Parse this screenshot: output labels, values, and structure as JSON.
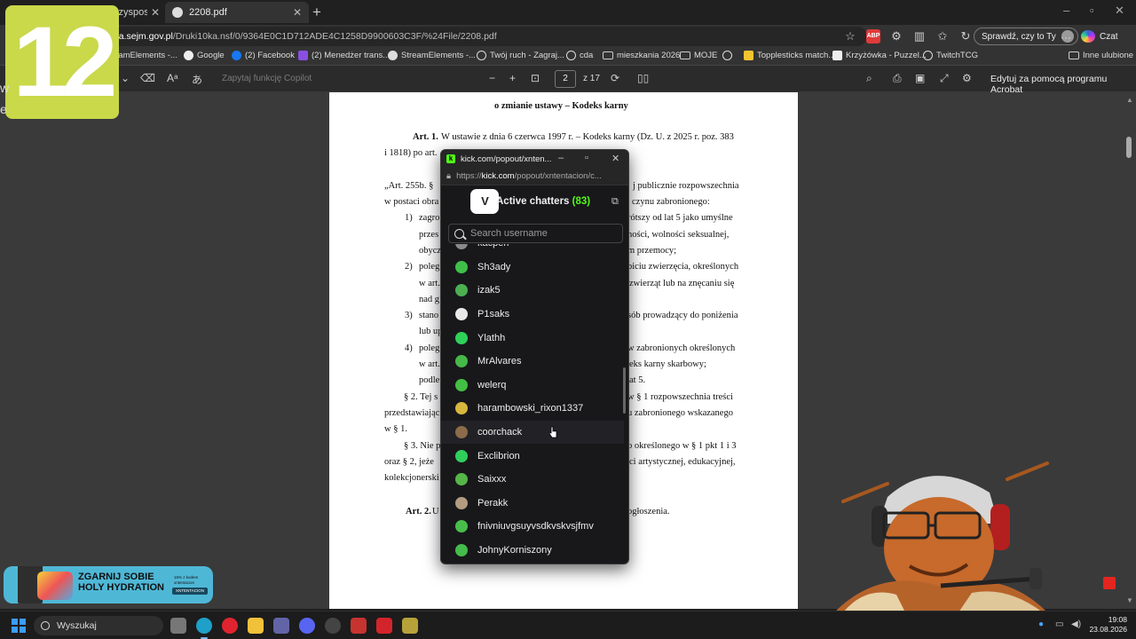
{
  "browser": {
    "tabs": [
      {
        "title": "czyspospo"
      },
      {
        "title": "2208.pdf"
      }
    ],
    "url": {
      "host": "rka.sejm.gov.pl",
      "path": "/Druki10ka.nsf/0/9364E0C1D712ADE4C1258D9900603C3F/%24File/2208.pdf"
    },
    "sign_in_label": "Sprawdź, czy to Ty",
    "copilot_label": "Czat",
    "other_favorites": "Inne ulubione",
    "bookmarks": [
      {
        "label": "eamElements -..."
      },
      {
        "label": "Google"
      },
      {
        "label": "(2) Facebook"
      },
      {
        "label": "(2) Menedżer trans..."
      },
      {
        "label": "StreamElements -..."
      },
      {
        "label": "Twój ruch - Zagraj..."
      },
      {
        "label": "cda"
      },
      {
        "label": "mieszkania 2026"
      },
      {
        "label": "MOJE"
      },
      {
        "label": "Topplesticks match..."
      },
      {
        "label": "Krzyżówka - Puzzel..."
      },
      {
        "label": "TwitchTCG"
      }
    ]
  },
  "pdf_toolbar": {
    "ask_copilot": "Zapytaj funkcję Copilot",
    "page_number": "2",
    "page_total": "z 17",
    "edit_acrobat": "Edytuj za pomocą programu Acrobat"
  },
  "document": {
    "heading": "o zmianie ustawy – Kodeks karny",
    "art1_label": "Art. 1.",
    "art1_line1": "W ustawie z dnia 6 czerwca 1997 r. – Kodeks karny (Dz. U. z 2025 r. poz. 383",
    "art1_line2a": "i 1818) po art.",
    "art255_start": "„Art. 255b. §",
    "art255_right": "j publicznie rozpowszechnia",
    "art255_line2a": "w postaci obra",
    "art255_line2b": "czynu zabronionego:",
    "i1_num": "1)",
    "i1_a": "zagro",
    "i1_a_r": "rótszy od lat 5 jako umyślne",
    "i1_b": "przes",
    "i1_b_r": "ności,   wolności   seksualnej,",
    "i1_c": "obycz",
    "i1_c_r": "m przemocy;",
    "i2_num": "2)",
    "i2_a": "poleg",
    "i2_a_r": "biciu zwierzęcia, określonych",
    "i2_b": "w art.",
    "i2_b_r": "zwierząt lub na znęcaniu się",
    "i2_c": "nad g",
    "i3_num": "3)",
    "i3_a": "stano",
    "i3_a_r": "sób prowadzący do poniżenia",
    "i3_b": "lub up",
    "i4_num": "4)",
    "i4_a": "poleg",
    "i4_a_r": "w zabronionych określonych",
    "i4_b": "w art.",
    "i4_b_r": "eks karny skarbowy;",
    "i4_c": "podle",
    "i4_c_r": "at 5.",
    "p2_a": "§ 2. Tej s",
    "p2_a_r": "w § 1 rozpowszechnia treści",
    "p2_b": "przedstawiając",
    "p2_b_r": "u zabronionego wskazanego",
    "p2_c": "w § 1.",
    "p3_a": "§ 3. Nie p",
    "p3_a_r": "o określonego w § 1 pkt 1 i 3",
    "p3_b": "oraz § 2, jeże",
    "p3_b_r": "ci artystycznej, edukacyjnej,",
    "p3_c": "kolekcjonerski",
    "art2_label": "Art. 2.",
    "art2_a": "U",
    "art2_r": "ogłoszenia."
  },
  "popout": {
    "window_title": "kick.com/popout/xnten...",
    "url_host": "kick.com",
    "url_prefix": "https://",
    "url_path": "/popout/xntentacion/c...",
    "logo_text": "V",
    "title": "Active chatters",
    "count": "(83)",
    "search_placeholder": "Search username",
    "chatters": [
      {
        "name": "kacperr",
        "avatar_color": "#8a8a8a"
      },
      {
        "name": "Sh3ady",
        "avatar_color": "#3fbf4a"
      },
      {
        "name": "izak5",
        "avatar_color": "#4caf50"
      },
      {
        "name": "P1saks",
        "avatar_color": "#e8e8e8"
      },
      {
        "name": "Ylathh",
        "avatar_color": "#2ed158"
      },
      {
        "name": "MrAlvares",
        "avatar_color": "#46b84a"
      },
      {
        "name": "welerq",
        "avatar_color": "#43c043"
      },
      {
        "name": "harambowski_rixon1337",
        "avatar_color": "#d7b73c"
      },
      {
        "name": "coorchack",
        "avatar_color": "#8c6b4a"
      },
      {
        "name": "Exclibrion",
        "avatar_color": "#2fcf5c"
      },
      {
        "name": "Saixxx",
        "avatar_color": "#54b748"
      },
      {
        "name": "Perakk",
        "avatar_color": "#b49b80"
      },
      {
        "name": "fnivniuvgsuyvsdkvskvsjfmv",
        "avatar_color": "#49bd4c"
      },
      {
        "name": "JohnyKorniszony",
        "avatar_color": "#45bb4b"
      }
    ]
  },
  "overlay": {
    "badge_number": "12",
    "stray_letters": [
      "w",
      "e"
    ],
    "promo_title": "ZGARNIJ SOBIE HOLY HYDRATION",
    "promo_small": "15% z kodem xntentacion",
    "promo_tag": "XNTENTACION"
  },
  "taskbar": {
    "search_label": "Wyszukaj",
    "time": "19:08",
    "date": "23.08.2026"
  },
  "colors": {
    "kick_green": "#53fc18",
    "badge": "#c9d94a",
    "promo": "#4fb7d6",
    "start": "#3a9dff"
  }
}
